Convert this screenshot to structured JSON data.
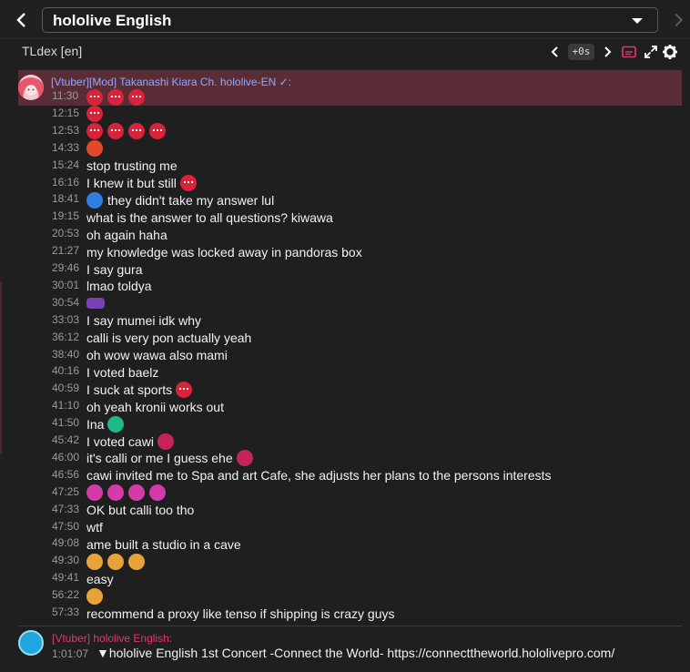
{
  "topbar": {
    "channel": "hololive English"
  },
  "subbar": {
    "title": "TLdex [en]",
    "offset": "+0s"
  },
  "header": {
    "author": "[Vtuber][Mod] Takanashi Kiara Ch. hololive-EN ✓:"
  },
  "messages": [
    {
      "time": "11:30",
      "text": "",
      "emotes": [
        "tako",
        "tako",
        "tako"
      ]
    },
    {
      "time": "12:15",
      "text": "",
      "emotes": [
        "tako"
      ]
    },
    {
      "time": "12:53",
      "text": "",
      "emotes": [
        "tako",
        "tako",
        "tako",
        "tako"
      ]
    },
    {
      "time": "14:33",
      "text": "",
      "emotes": [
        "tako2"
      ]
    },
    {
      "time": "15:24",
      "text": "stop trusting me",
      "emotes": []
    },
    {
      "time": "16:16",
      "text": "I knew it but still",
      "emotes": [
        "tako"
      ],
      "trail": true
    },
    {
      "time": "18:41",
      "text": "they didn't take my answer lul",
      "emotes": [
        "shark"
      ]
    },
    {
      "time": "19:15",
      "text": "what is the answer to all questions? kiwawa",
      "emotes": []
    },
    {
      "time": "20:53",
      "text": "oh again haha",
      "emotes": []
    },
    {
      "time": "21:27",
      "text": "my knowledge was locked away in pandoras box",
      "emotes": []
    },
    {
      "time": "29:46",
      "text": "I say gura",
      "emotes": []
    },
    {
      "time": "30:01",
      "text": "lmao toldya",
      "emotes": []
    },
    {
      "time": "30:54",
      "text": "",
      "emotes": [
        "owl"
      ]
    },
    {
      "time": "33:03",
      "text": "I say mumei idk why",
      "emotes": []
    },
    {
      "time": "36:12",
      "text": "calli is very pon actually yeah",
      "emotes": []
    },
    {
      "time": "38:40",
      "text": "oh wow wawa also mami",
      "emotes": []
    },
    {
      "time": "40:16",
      "text": "I voted baelz",
      "emotes": []
    },
    {
      "time": "40:59",
      "text": "I suck at sports",
      "emotes": [
        "tako"
      ],
      "trail": true
    },
    {
      "time": "41:10",
      "text": "oh yeah kronii works out",
      "emotes": []
    },
    {
      "time": "41:50",
      "text": "Ina",
      "emotes": [
        "ghost"
      ],
      "trail": true
    },
    {
      "time": "45:42",
      "text": "I voted cawi",
      "emotes": [
        "heart"
      ],
      "trail": true
    },
    {
      "time": "46:00",
      "text": "it's calli or me I guess ehe",
      "emotes": [
        "heart"
      ],
      "trail": true
    },
    {
      "time": "46:56",
      "text": "cawi invited me to Spa and art Cafe, she adjusts her plans to the persons interests",
      "emotes": []
    },
    {
      "time": "47:25",
      "text": "",
      "emotes": [
        "pink",
        "pink",
        "pink",
        "pink"
      ]
    },
    {
      "time": "47:33",
      "text": "OK but calli too tho",
      "emotes": []
    },
    {
      "time": "47:50",
      "text": "wtf",
      "emotes": []
    },
    {
      "time": "49:08",
      "text": "ame built a studio in a cave",
      "emotes": []
    },
    {
      "time": "49:30",
      "text": "",
      "emotes": [
        "sad",
        "sad",
        "sad"
      ]
    },
    {
      "time": "49:41",
      "text": "easy",
      "emotes": []
    },
    {
      "time": "56:22",
      "text": "",
      "emotes": [
        "sad"
      ]
    },
    {
      "time": "57:33",
      "text": "recommend a proxy like tenso if shipping is crazy guys",
      "emotes": []
    }
  ],
  "footer": {
    "author": "[Vtuber] hololive English:",
    "time": "1:01:07",
    "text": "▼hololive English 1st Concert -Connect the World- https://connecttheworld.hololivepro.com/"
  }
}
